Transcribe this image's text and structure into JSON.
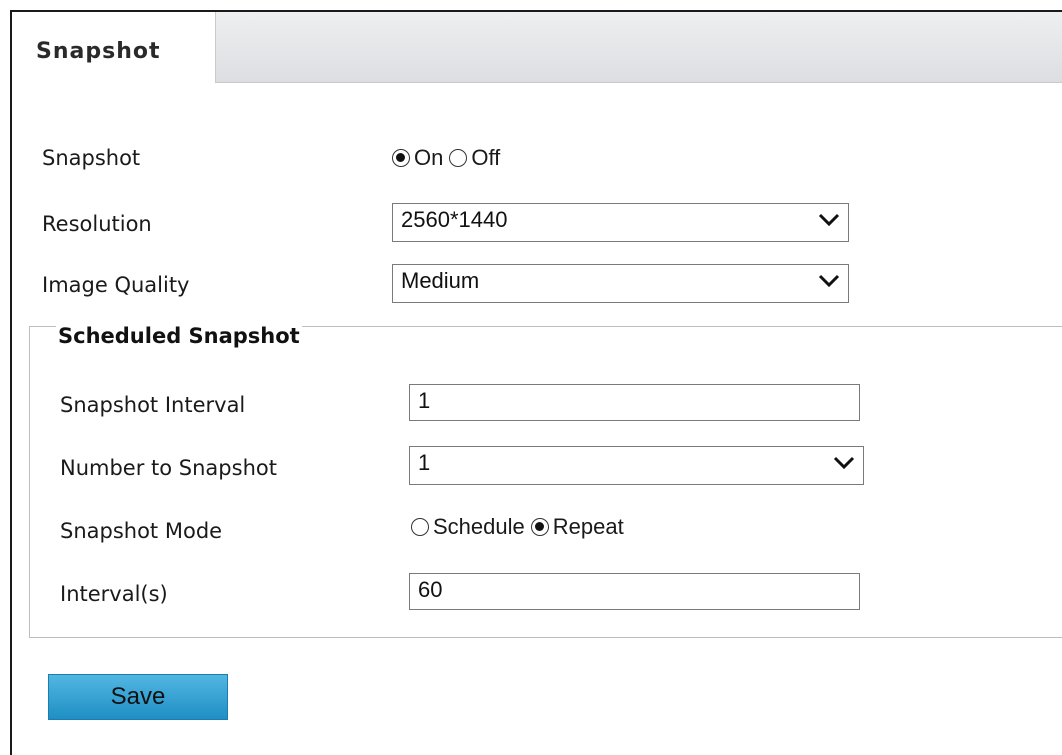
{
  "tab": {
    "label": "Snapshot"
  },
  "snapshot": {
    "label": "Snapshot",
    "options": [
      {
        "label": "On",
        "checked": true
      },
      {
        "label": "Off",
        "checked": false
      }
    ]
  },
  "resolution": {
    "label": "Resolution",
    "value": "2560*1440"
  },
  "image_quality": {
    "label": "Image Quality",
    "value": "Medium"
  },
  "scheduled": {
    "title": "Scheduled Snapshot",
    "interval": {
      "label": "Snapshot Interval",
      "value": "1"
    },
    "number": {
      "label": "Number to Snapshot",
      "value": "1"
    },
    "mode": {
      "label": "Snapshot Mode",
      "options": [
        {
          "label": "Schedule",
          "checked": false
        },
        {
          "label": "Repeat",
          "checked": true
        }
      ]
    },
    "interval_s": {
      "label": "Interval(s)",
      "value": "60"
    }
  },
  "save_label": "Save",
  "icons": {
    "dropdown": "chevron-down-icon",
    "radio": "radio-button-icon"
  }
}
